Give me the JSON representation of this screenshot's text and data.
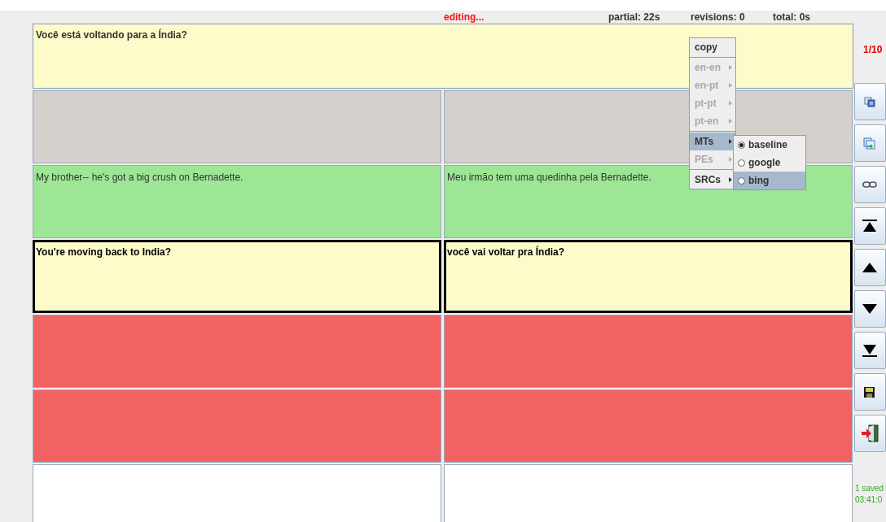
{
  "status_bar": {
    "editing": "editing...",
    "partial": "partial: 22s",
    "revisions": "revisions: 0",
    "total": "total: 0s"
  },
  "source_box": {
    "text": "Você está voltando para a Índia?"
  },
  "counter": "1/10",
  "rows": [
    {
      "kind": "empty"
    },
    {
      "kind": "done",
      "left": "My brother-- he's got a big crush on Bernadette.",
      "right": "Meu irmão tem uma quedinha pela Bernadette."
    },
    {
      "kind": "current",
      "left": "You're moving back to India?",
      "right": "você vai voltar pra Índia?"
    },
    {
      "kind": "pending"
    },
    {
      "kind": "pending"
    },
    {
      "kind": "blank"
    }
  ],
  "context_menu": {
    "items": [
      {
        "kind": "item",
        "label": "copy",
        "disabled": false,
        "selected": false
      },
      {
        "kind": "separator"
      },
      {
        "kind": "submenu",
        "label": "en-en",
        "disabled": true,
        "selected": false
      },
      {
        "kind": "submenu",
        "label": "en-pt",
        "disabled": true,
        "selected": false
      },
      {
        "kind": "submenu",
        "label": "pt-pt",
        "disabled": true,
        "selected": false
      },
      {
        "kind": "submenu",
        "label": "pt-en",
        "disabled": true,
        "selected": false
      },
      {
        "kind": "separator"
      },
      {
        "kind": "submenu",
        "label": "MTs",
        "disabled": false,
        "selected": true
      },
      {
        "kind": "submenu",
        "label": "PEs",
        "disabled": true,
        "selected": false
      },
      {
        "kind": "separator"
      },
      {
        "kind": "submenu",
        "label": "SRCs",
        "disabled": false,
        "selected": false
      }
    ],
    "submenu": [
      {
        "label": "baseline",
        "checked": true,
        "selected": false
      },
      {
        "label": "google",
        "checked": false,
        "selected": false
      },
      {
        "label": "bing",
        "checked": false,
        "selected": true
      }
    ]
  },
  "save_status": [
    "1 saved",
    "03:41:0"
  ]
}
